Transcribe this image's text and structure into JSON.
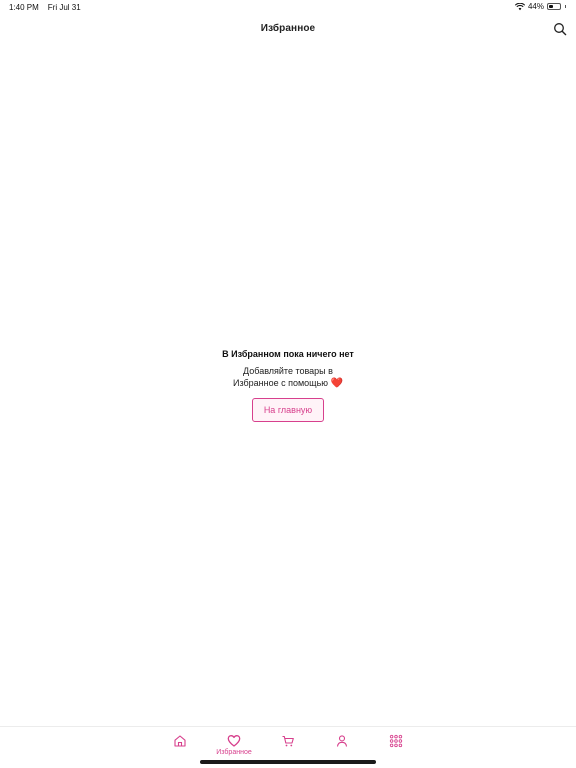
{
  "status": {
    "time": "1:40 PM",
    "date": "Fri Jul 31",
    "battery": "44%",
    "battery_level": 0.44
  },
  "nav": {
    "title": "Избранное",
    "search_icon": "search-icon"
  },
  "empty": {
    "title": "В Избранном пока ничего нет",
    "line1": "Добавляйте товары в",
    "line2": "Избранное с помощью",
    "heart": "❤️",
    "button": "На главную"
  },
  "tabs": [
    {
      "icon": "home-icon",
      "label": ""
    },
    {
      "icon": "heart-icon",
      "label": "Избранное",
      "active": true
    },
    {
      "icon": "cart-icon",
      "label": ""
    },
    {
      "icon": "profile-icon",
      "label": ""
    },
    {
      "icon": "grid-icon",
      "label": ""
    }
  ],
  "colors": {
    "accent": "#d7408d",
    "heart": "#e0334a",
    "button_bg": "#fff3f8"
  }
}
